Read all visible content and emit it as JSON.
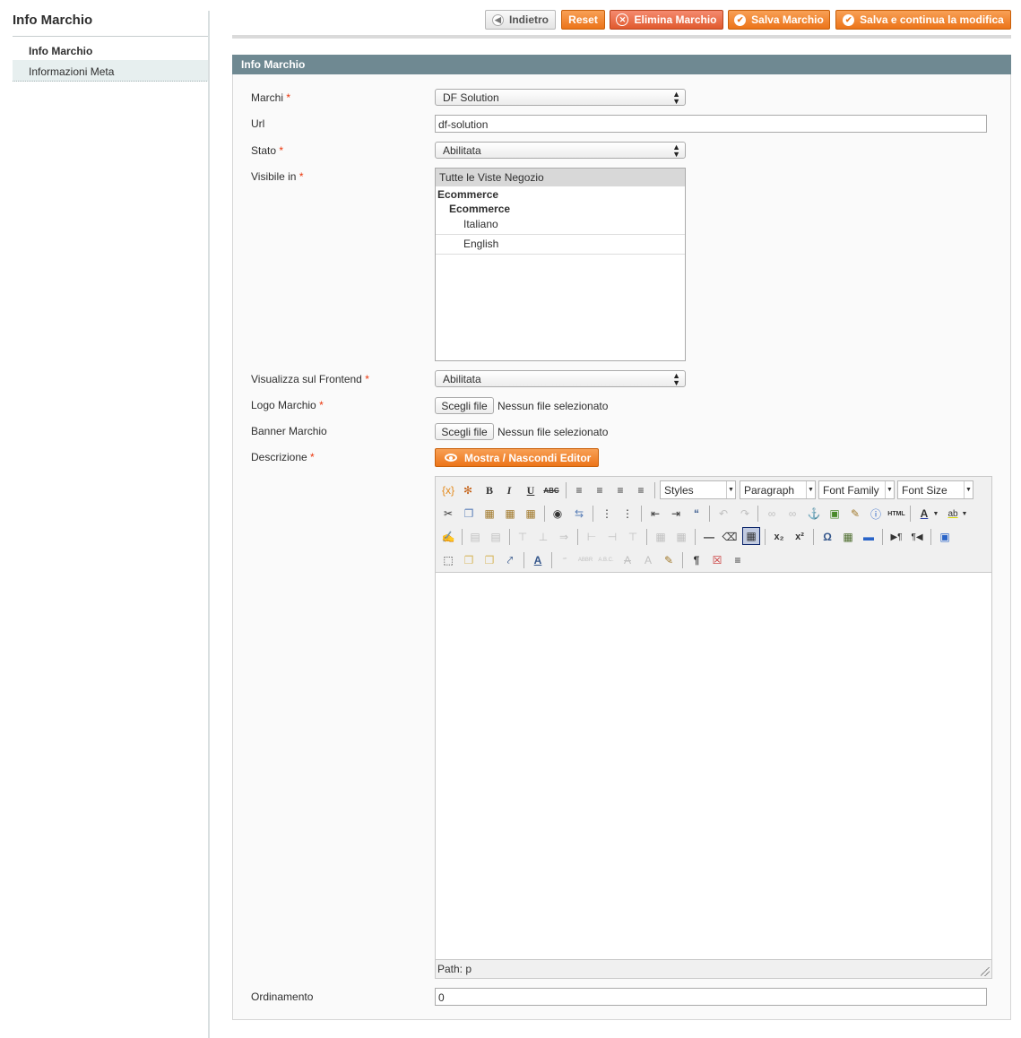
{
  "sidebar": {
    "title": "Info Marchio",
    "tabs": [
      {
        "label": "Info Marchio"
      },
      {
        "label": "Informazioni Meta"
      }
    ]
  },
  "buttons": {
    "back": "Indietro",
    "reset": "Reset",
    "delete": "Elimina Marchio",
    "save": "Salva Marchio",
    "save_continue": "Salva e continua la modifica"
  },
  "panel": {
    "title": "Info Marchio"
  },
  "form": {
    "marchi": {
      "label": "Marchi",
      "required": "*",
      "value": "DF Solution"
    },
    "url": {
      "label": "Url",
      "value": "df-solution"
    },
    "stato": {
      "label": "Stato",
      "required": "*",
      "value": "Abilitata"
    },
    "visibile": {
      "label": "Visibile in",
      "required": "*",
      "options": [
        "Tutte le Viste Negozio",
        "Ecommerce",
        "Ecommerce",
        "Italiano",
        "English"
      ]
    },
    "frontend": {
      "label": "Visualizza sul Frontend",
      "required": "*",
      "value": "Abilitata"
    },
    "logo": {
      "label": "Logo Marchio",
      "required": "*",
      "button": "Scegli file",
      "status": "Nessun file selezionato"
    },
    "banner": {
      "label": "Banner Marchio",
      "button": "Scegli file",
      "status": "Nessun file selezionato"
    },
    "descrizione": {
      "label": "Descrizione",
      "required": "*",
      "toggle_button": "Mostra / Nascondi Editor"
    },
    "ordinamento": {
      "label": "Ordinamento",
      "value": "0"
    }
  },
  "editor": {
    "styles": "Styles",
    "format": "Paragraph",
    "font_family": "Font Family",
    "font_size": "Font Size",
    "path": "Path: p"
  },
  "colors": {
    "accent": "#ec7419",
    "panel_header": "#6f8992",
    "required": "#eb340a"
  }
}
